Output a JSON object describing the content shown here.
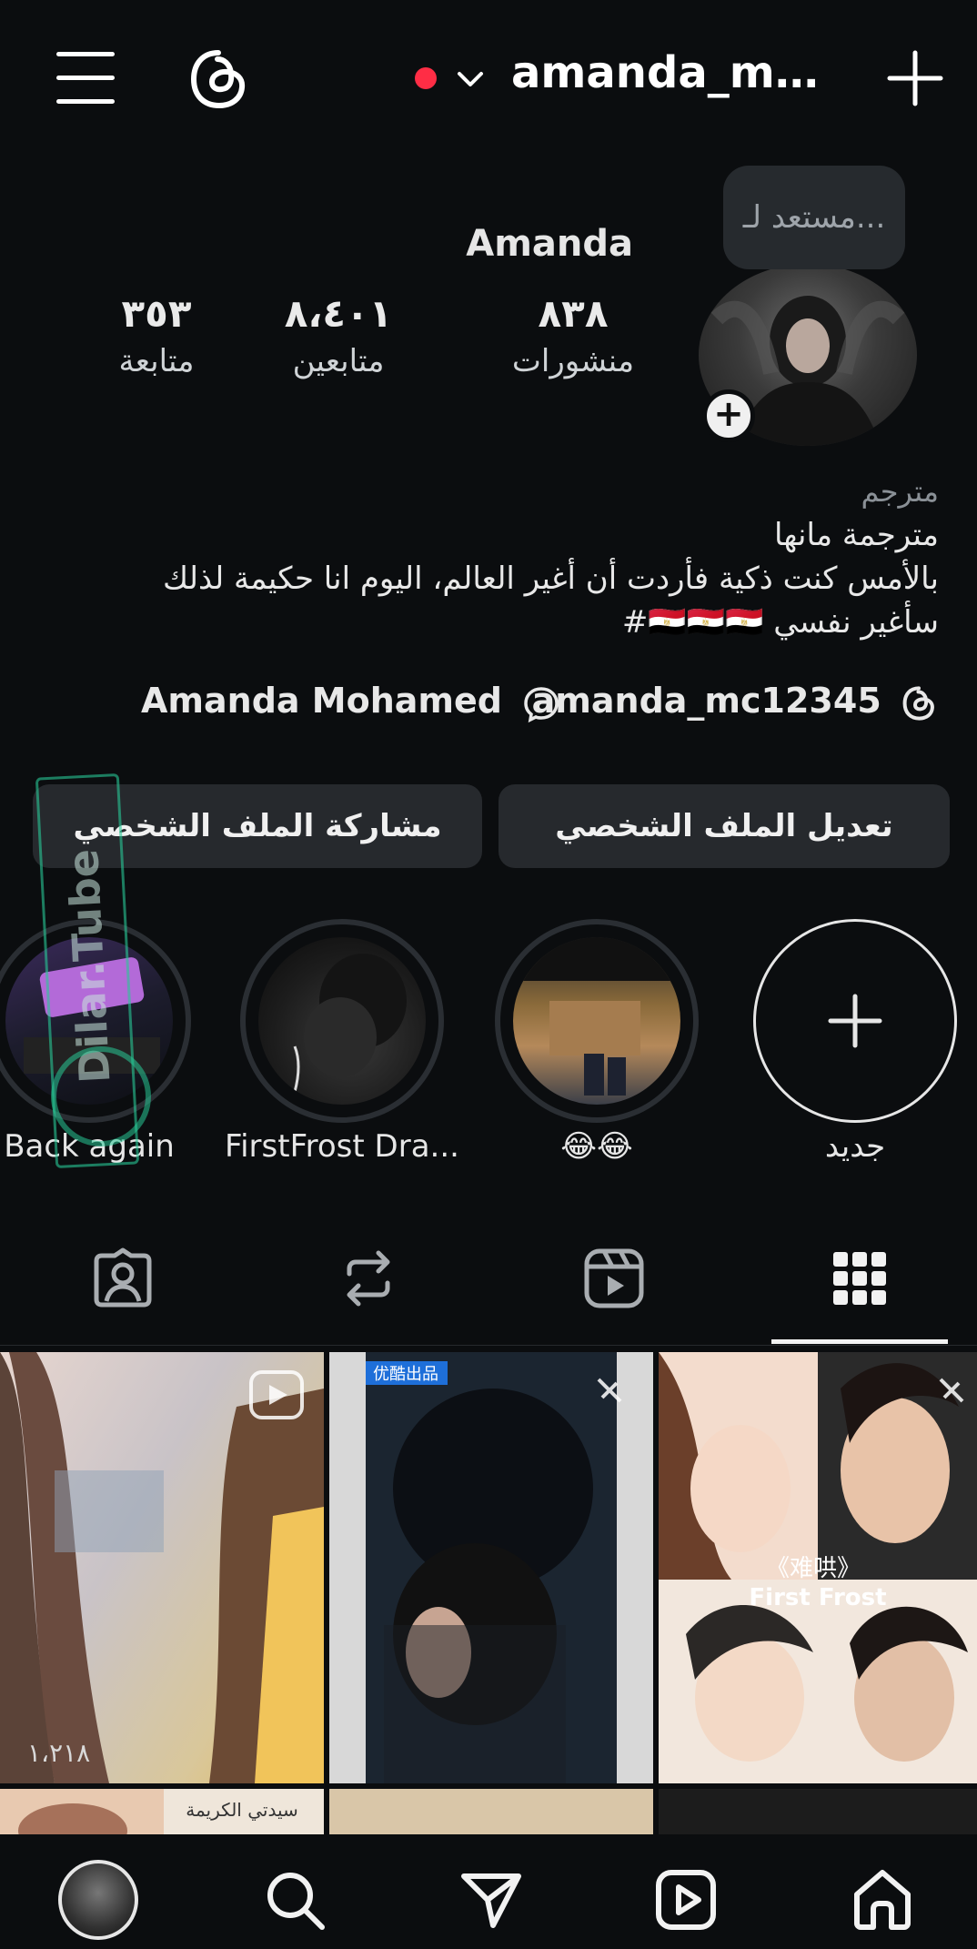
{
  "top_bar": {
    "username": "amanda_mc..."
  },
  "profile": {
    "note": "مستعد لـ...",
    "display_name": "Amanda",
    "stats": {
      "posts": {
        "value": "٨٣٨",
        "label": "منشورات"
      },
      "followers": {
        "value": "٨،٤٠١",
        "label": "متابعين"
      },
      "following": {
        "value": "٣٥٣",
        "label": "متابعة"
      }
    },
    "bio": {
      "category": "مترجم",
      "line1": "مترجمة مانها",
      "line2": "بالأمس كنت ذكية فأردت أن أغير العالم، اليوم انا حكيمة لذلك",
      "line3": "سأغير نفسي 🇪🇬🇪🇬🇪🇬#"
    },
    "links": {
      "threads_handle": "amanda_mc12345",
      "fb_name": "Amanda Mohamed"
    }
  },
  "buttons": {
    "edit_profile": "تعديل الملف الشخصي",
    "share_profile": "مشاركة الملف الشخصي"
  },
  "highlights": {
    "new_label": "جديد",
    "items": [
      {
        "label": "😂😂"
      },
      {
        "label": "FirstFrost Dra..."
      },
      {
        "label": "Back again"
      }
    ]
  },
  "watermark": {
    "text": "Dilar.Tube"
  },
  "grid": {
    "first_views": "١،٢١٨",
    "poster_texts": [
      "优酷出品",
      "《难哄》",
      "First Frost",
      "سيدتي الكريمة"
    ]
  },
  "colors": {
    "background": "#0b0d0f",
    "button_bg": "#26292d",
    "status_dot": "#ff2d45"
  }
}
